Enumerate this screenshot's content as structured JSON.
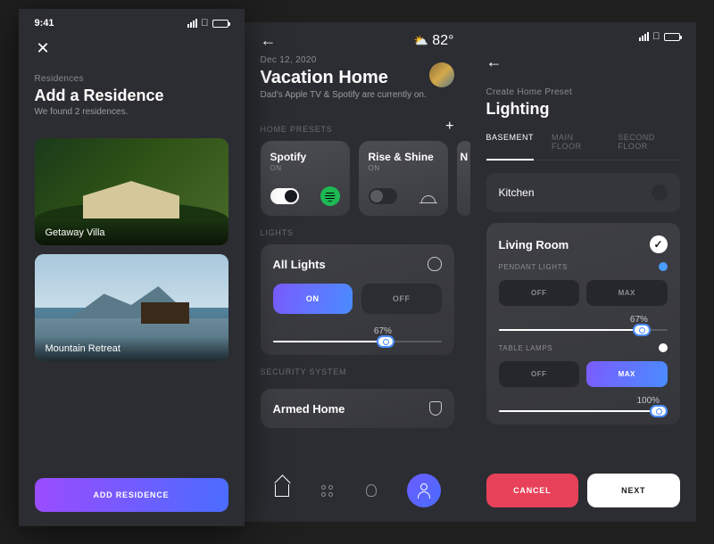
{
  "screen1": {
    "status_time": "9:41",
    "overline": "Residences",
    "title": "Add a Residence",
    "subtitle": "We found 2 residences.",
    "card1_label": "Getaway Villa",
    "card2_label": "Mountain Retreat",
    "cta": "ADD RESIDENCE"
  },
  "screen2": {
    "temp": "82°",
    "date": "Dec 12, 2020",
    "title": "Vacation Home",
    "subtitle": "Dad's Apple TV & Spotify are currently on.",
    "section_presets": "HOME PRESETS",
    "preset1_title": "Spotify",
    "preset1_status": "ON",
    "preset2_title": "Rise & Shine",
    "preset2_status": "ON",
    "preset3_title": "N",
    "section_lights": "LIGHTS",
    "lights_title": "All Lights",
    "btn_on": "ON",
    "btn_off": "OFF",
    "slider_pct": "67%",
    "section_security": "SECURITY SYSTEM",
    "security_title": "Armed Home"
  },
  "screen3": {
    "overline": "Create Home Preset",
    "title": "Lighting",
    "tab1": "BASEMENT",
    "tab2": "MAIN FLOOR",
    "tab3": "SECOND FLOOR",
    "room1": "Kitchen",
    "room2": "Living Room",
    "light1_label": "PENDANT LIGHTS",
    "light2_label": "TABLE LAMPS",
    "off": "OFF",
    "max": "MAX",
    "pct1": "67%",
    "pct2": "100%",
    "btn_cancel": "CANCEL",
    "btn_next": "NEXT"
  }
}
